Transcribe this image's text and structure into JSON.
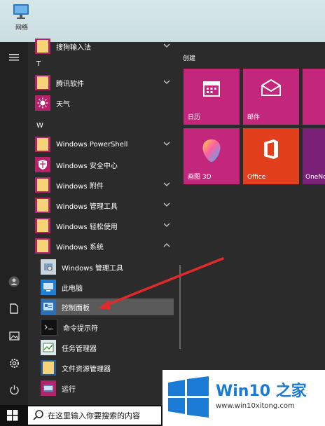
{
  "desktop": {
    "icon_label": "网络"
  },
  "rail": {
    "icons": [
      "hamburger-icon",
      "user-icon",
      "document-icon",
      "picture-icon",
      "gear-icon",
      "power-icon"
    ]
  },
  "apps": {
    "partial_item": "搜狗输入法",
    "letter_t": "T",
    "tencent": "腾讯软件",
    "weather": "天气",
    "letter_w": "W",
    "powershell": "Windows PowerShell",
    "security": "Windows 安全中心",
    "accessories": "Windows 附件",
    "admin_tools": "Windows 管理工具",
    "ease": "Windows 轻松使用",
    "system": "Windows 系统",
    "sub_admin": "Windows 管理工具",
    "this_pc": "此电脑",
    "control_panel": "控制面板",
    "cmd": "命令提示符",
    "task_mgr": "任务管理器",
    "explorer": "文件资源管理器",
    "run": "运行"
  },
  "tiles": {
    "group": "创建",
    "calendar": "日历",
    "mail": "邮件",
    "paint3d": "画图 3D",
    "office": "Office",
    "onenote": "OneNo"
  },
  "taskbar": {
    "search_placeholder": "在这里输入你要搜索的内容"
  },
  "watermark": {
    "brand": "Win10 之家",
    "url": "www.win10xitong.com"
  },
  "colors": {
    "tile_pink": "#c2277c",
    "tile_orange": "#e2401c",
    "tile_purple": "#7b2077",
    "folder": "#f5d376",
    "arrow": "#e02a2a"
  }
}
